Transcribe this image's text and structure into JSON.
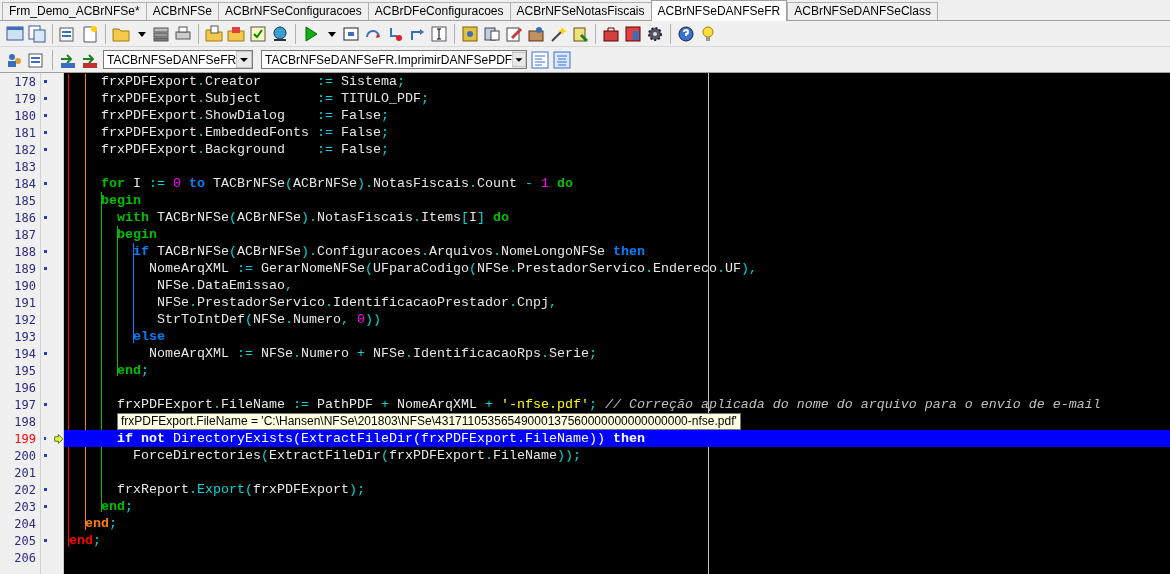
{
  "tabs": [
    {
      "label": "Frm_Demo_ACBrNFSe*",
      "selected": false
    },
    {
      "label": "ACBrNFSe",
      "selected": false
    },
    {
      "label": "ACBrNFSeConfiguracoes",
      "selected": false
    },
    {
      "label": "ACBrDFeConfiguracoes",
      "selected": false
    },
    {
      "label": "ACBrNFSeNotasFiscais",
      "selected": false
    },
    {
      "label": "ACBrNFSeDANFSeFR",
      "selected": true
    },
    {
      "label": "ACBrNFSeDANFSeClass",
      "selected": false
    }
  ],
  "navigator": {
    "class_combo": "TACBrNFSeDANFSeFR",
    "method_combo": "TACBrNFSeDANFSeFR.ImprimirDANFSePDF"
  },
  "editor": {
    "lines": [
      {
        "number": "178",
        "dot": true,
        "current": false,
        "tokens": [
          {
            "kind": "id",
            "text": "    frxPDFExport"
          },
          {
            "kind": "sym",
            "text": "."
          },
          {
            "kind": "id",
            "text": "Creator       "
          },
          {
            "kind": "sym",
            "text": ":="
          },
          {
            "kind": "id",
            "text": " Sistema"
          },
          {
            "kind": "sym",
            "text": ";"
          }
        ]
      },
      {
        "number": "179",
        "dot": true,
        "current": false,
        "tokens": [
          {
            "kind": "id",
            "text": "    frxPDFExport"
          },
          {
            "kind": "sym",
            "text": "."
          },
          {
            "kind": "id",
            "text": "Subject       "
          },
          {
            "kind": "sym",
            "text": ":="
          },
          {
            "kind": "id",
            "text": " TITULO_PDF"
          },
          {
            "kind": "sym",
            "text": ";"
          }
        ]
      },
      {
        "number": "180",
        "dot": true,
        "current": false,
        "tokens": [
          {
            "kind": "id",
            "text": "    frxPDFExport"
          },
          {
            "kind": "sym",
            "text": "."
          },
          {
            "kind": "id",
            "text": "ShowDialog    "
          },
          {
            "kind": "sym",
            "text": ":="
          },
          {
            "kind": "id",
            "text": " False"
          },
          {
            "kind": "sym",
            "text": ";"
          }
        ]
      },
      {
        "number": "181",
        "dot": true,
        "current": false,
        "tokens": [
          {
            "kind": "id",
            "text": "    frxPDFExport"
          },
          {
            "kind": "sym",
            "text": "."
          },
          {
            "kind": "id",
            "text": "EmbeddedFonts "
          },
          {
            "kind": "sym",
            "text": ":="
          },
          {
            "kind": "id",
            "text": " False"
          },
          {
            "kind": "sym",
            "text": ";"
          }
        ]
      },
      {
        "number": "182",
        "dot": true,
        "current": false,
        "tokens": [
          {
            "kind": "id",
            "text": "    frxPDFExport"
          },
          {
            "kind": "sym",
            "text": "."
          },
          {
            "kind": "id",
            "text": "Background    "
          },
          {
            "kind": "sym",
            "text": ":="
          },
          {
            "kind": "id",
            "text": " False"
          },
          {
            "kind": "sym",
            "text": ";"
          }
        ]
      },
      {
        "number": "183",
        "dot": false,
        "current": false
      },
      {
        "number": "184",
        "dot": true,
        "current": false,
        "tokens": [
          {
            "kind": "kw",
            "text": "    for",
            "color": "#00c000"
          },
          {
            "kind": "id",
            "text": " I "
          },
          {
            "kind": "sym",
            "text": ":= "
          },
          {
            "kind": "num",
            "text": "0"
          },
          {
            "kind": "kw",
            "text": " to",
            "color": "#0080ff"
          },
          {
            "kind": "id",
            "text": " TACBrNFSe"
          },
          {
            "kind": "sym",
            "text": "("
          },
          {
            "kind": "id",
            "text": "ACBrNFSe"
          },
          {
            "kind": "sym",
            "text": ")."
          },
          {
            "kind": "id",
            "text": "NotasFiscais"
          },
          {
            "kind": "sym",
            "text": "."
          },
          {
            "kind": "id",
            "text": "Count "
          },
          {
            "kind": "sym",
            "text": "- "
          },
          {
            "kind": "num",
            "text": "1"
          },
          {
            "kind": "kw",
            "text": " do",
            "color": "#00c000"
          }
        ]
      },
      {
        "number": "185",
        "dot": false,
        "current": false,
        "tokens": [
          {
            "kind": "kw",
            "text": "    begin",
            "color": "#00c000"
          }
        ]
      },
      {
        "number": "186",
        "dot": true,
        "current": false,
        "tokens": [
          {
            "kind": "kw",
            "text": "      with",
            "color": "#00c000"
          },
          {
            "kind": "id",
            "text": " TACBrNFSe"
          },
          {
            "kind": "sym",
            "text": "("
          },
          {
            "kind": "id",
            "text": "ACBrNFSe"
          },
          {
            "kind": "sym",
            "text": ")."
          },
          {
            "kind": "id",
            "text": "NotasFiscais"
          },
          {
            "kind": "sym",
            "text": "."
          },
          {
            "kind": "id",
            "text": "Items"
          },
          {
            "kind": "sym",
            "text": "["
          },
          {
            "kind": "id",
            "text": "I"
          },
          {
            "kind": "sym",
            "text": "]"
          },
          {
            "kind": "kw",
            "text": " do",
            "color": "#00c000"
          }
        ]
      },
      {
        "number": "187",
        "dot": false,
        "current": false,
        "tokens": [
          {
            "kind": "kw",
            "text": "      begin",
            "color": "#00c000"
          }
        ]
      },
      {
        "number": "188",
        "dot": true,
        "current": false,
        "tokens": [
          {
            "kind": "kw",
            "text": "        if",
            "color": "#0080ff"
          },
          {
            "kind": "id",
            "text": " TACBrNFSe"
          },
          {
            "kind": "sym",
            "text": "("
          },
          {
            "kind": "id",
            "text": "ACBrNFSe"
          },
          {
            "kind": "sym",
            "text": ")."
          },
          {
            "kind": "id",
            "text": "Configuracoes"
          },
          {
            "kind": "sym",
            "text": "."
          },
          {
            "kind": "id",
            "text": "Arquivos"
          },
          {
            "kind": "sym",
            "text": "."
          },
          {
            "kind": "id",
            "text": "NomeLongoNFSe "
          },
          {
            "kind": "kw",
            "text": "then",
            "color": "#0080ff"
          }
        ]
      },
      {
        "number": "189",
        "dot": true,
        "current": false,
        "tokens": [
          {
            "kind": "id",
            "text": "          NomeArqXML "
          },
          {
            "kind": "sym",
            "text": ":="
          },
          {
            "kind": "id",
            "text": " GerarNomeNFSe"
          },
          {
            "kind": "sym",
            "text": "("
          },
          {
            "kind": "id",
            "text": "UFparaCodigo"
          },
          {
            "kind": "sym",
            "text": "("
          },
          {
            "kind": "id",
            "text": "NFSe"
          },
          {
            "kind": "sym",
            "text": "."
          },
          {
            "kind": "id",
            "text": "PrestadorServico"
          },
          {
            "kind": "sym",
            "text": "."
          },
          {
            "kind": "id",
            "text": "Endereco"
          },
          {
            "kind": "sym",
            "text": "."
          },
          {
            "kind": "id",
            "text": "UF"
          },
          {
            "kind": "sym",
            "text": "),"
          }
        ]
      },
      {
        "number": "190",
        "dot": false,
        "current": false,
        "tokens": [
          {
            "kind": "id",
            "text": "           NFSe"
          },
          {
            "kind": "sym",
            "text": "."
          },
          {
            "kind": "id",
            "text": "DataEmissao"
          },
          {
            "kind": "sym",
            "text": ","
          }
        ]
      },
      {
        "number": "191",
        "dot": false,
        "current": false,
        "tokens": [
          {
            "kind": "id",
            "text": "           NFSe"
          },
          {
            "kind": "sym",
            "text": "."
          },
          {
            "kind": "id",
            "text": "PrestadorServico"
          },
          {
            "kind": "sym",
            "text": "."
          },
          {
            "kind": "id",
            "text": "IdentificacaoPrestador"
          },
          {
            "kind": "sym",
            "text": "."
          },
          {
            "kind": "id",
            "text": "Cnpj"
          },
          {
            "kind": "sym",
            "text": ","
          }
        ]
      },
      {
        "number": "192",
        "dot": false,
        "current": false,
        "tokens": [
          {
            "kind": "id",
            "text": "           StrToIntDef"
          },
          {
            "kind": "sym",
            "text": "("
          },
          {
            "kind": "id",
            "text": "NFSe"
          },
          {
            "kind": "sym",
            "text": "."
          },
          {
            "kind": "id",
            "text": "Numero"
          },
          {
            "kind": "sym",
            "text": ", "
          },
          {
            "kind": "num",
            "text": "0"
          },
          {
            "kind": "sym",
            "text": "))"
          }
        ]
      },
      {
        "number": "193",
        "dot": false,
        "current": false,
        "tokens": [
          {
            "kind": "kw",
            "text": "        else",
            "color": "#0080ff"
          }
        ]
      },
      {
        "number": "194",
        "dot": true,
        "current": false,
        "tokens": [
          {
            "kind": "id",
            "text": "          NomeArqXML "
          },
          {
            "kind": "sym",
            "text": ":="
          },
          {
            "kind": "id",
            "text": " NFSe"
          },
          {
            "kind": "sym",
            "text": "."
          },
          {
            "kind": "id",
            "text": "Numero "
          },
          {
            "kind": "sym",
            "text": "+"
          },
          {
            "kind": "id",
            "text": " NFSe"
          },
          {
            "kind": "sym",
            "text": "."
          },
          {
            "kind": "id",
            "text": "IdentificacaoRps"
          },
          {
            "kind": "sym",
            "text": "."
          },
          {
            "kind": "id",
            "text": "Serie"
          },
          {
            "kind": "sym",
            "text": ";"
          }
        ]
      },
      {
        "number": "195",
        "dot": false,
        "current": false,
        "tokens": [
          {
            "kind": "kw",
            "text": "      end",
            "color": "#00c000"
          },
          {
            "kind": "sym",
            "text": ";"
          }
        ]
      },
      {
        "number": "196",
        "dot": false,
        "current": false
      },
      {
        "number": "197",
        "dot": true,
        "current": false,
        "tokens": [
          {
            "kind": "id",
            "text": "      frxPDFExport"
          },
          {
            "kind": "sym",
            "text": "."
          },
          {
            "kind": "id",
            "text": "FileName "
          },
          {
            "kind": "sym",
            "text": ":="
          },
          {
            "kind": "id",
            "text": " PathPDF "
          },
          {
            "kind": "sym",
            "text": "+"
          },
          {
            "kind": "id",
            "text": " NomeArqXML "
          },
          {
            "kind": "sym",
            "text": "+ "
          },
          {
            "kind": "str",
            "text": "'-nfse.pdf'"
          },
          {
            "kind": "sym",
            "text": ";"
          },
          {
            "kind": "cmt",
            "text": " // Correção aplicada do nome do arquivo para o envio de e-mail"
          }
        ]
      },
      {
        "number": "198",
        "dot": false,
        "current": false
      },
      {
        "number": "199",
        "dot": true,
        "current": true,
        "tokens": [
          {
            "kind": "kw",
            "text": "      if"
          },
          {
            "kind": "kw",
            "text": " not"
          },
          {
            "kind": "id",
            "text": " DirectoryExists"
          },
          {
            "kind": "sym",
            "text": "("
          },
          {
            "kind": "id",
            "text": "ExtractFileDir"
          },
          {
            "kind": "sym",
            "text": "("
          },
          {
            "kind": "id",
            "text": "frxPDFExport"
          },
          {
            "kind": "sym",
            "text": "."
          },
          {
            "kind": "id",
            "text": "FileName"
          },
          {
            "kind": "sym",
            "text": "))"
          },
          {
            "kind": "kw",
            "text": " then"
          }
        ]
      },
      {
        "number": "200",
        "dot": true,
        "current": false,
        "tokens": [
          {
            "kind": "id",
            "text": "        ForceDirectories"
          },
          {
            "kind": "sym",
            "text": "("
          },
          {
            "kind": "id",
            "text": "ExtractFileDir"
          },
          {
            "kind": "sym",
            "text": "("
          },
          {
            "kind": "id",
            "text": "frxPDFExport"
          },
          {
            "kind": "sym",
            "text": "."
          },
          {
            "kind": "id",
            "text": "FileName"
          },
          {
            "kind": "sym",
            "text": "));"
          }
        ]
      },
      {
        "number": "201",
        "dot": false,
        "current": false
      },
      {
        "number": "202",
        "dot": true,
        "current": false,
        "tokens": [
          {
            "kind": "id",
            "text": "      frxReport"
          },
          {
            "kind": "sym",
            "text": "."
          },
          {
            "kind": "sym",
            "text": "Export"
          },
          {
            "kind": "sym",
            "text": "("
          },
          {
            "kind": "id",
            "text": "frxPDFExport"
          },
          {
            "kind": "sym",
            "text": ");"
          }
        ]
      },
      {
        "number": "203",
        "dot": true,
        "current": false,
        "tokens": [
          {
            "kind": "kw",
            "text": "    end",
            "color": "#00c000"
          },
          {
            "kind": "sym",
            "text": ";"
          }
        ]
      },
      {
        "number": "204",
        "dot": false,
        "current": false,
        "tokens": [
          {
            "kind": "kw",
            "text": "  end",
            "color": "#ff8000"
          },
          {
            "kind": "sym",
            "text": ";"
          }
        ]
      },
      {
        "number": "205",
        "dot": true,
        "current": false,
        "tokens": [
          {
            "kind": "kw",
            "text": "end",
            "color": "#ff0000"
          },
          {
            "kind": "sym",
            "text": ";"
          }
        ]
      },
      {
        "number": "206",
        "dot": false,
        "current": false
      }
    ],
    "hint": {
      "text": "frxPDFExport.FileName = 'C:\\Hansen\\NFSe\\201803\\NFSe\\43171105356549000137560000000000000000-nfse.pdf'"
    }
  }
}
